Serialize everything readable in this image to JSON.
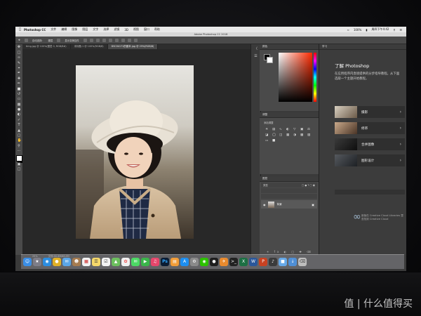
{
  "mac_menu": {
    "items": [
      "Photoshop CC",
      "文件",
      "编辑",
      "图像",
      "图层",
      "文字",
      "选择",
      "滤镜",
      "3D",
      "视图",
      "窗口",
      "帮助"
    ],
    "battery": "100%",
    "clock": "周四下午4:42"
  },
  "window_title": "Adobe Photoshop CC 2018",
  "options_bar": {
    "auto_select": "自动选择:",
    "layer": "图层",
    "show_transform": "显示变换控件"
  },
  "doc_tabs": [
    "timg.jpg @ 100%(图层 0, RGB/8#)",
    "未标题-1 @ 100%(RGB/8)",
    "DSC04171的副本.jpg @ 25%(RGB/8)"
  ],
  "status": {
    "zoom": "25%",
    "doc_info": "文档:68.8M/68.8M"
  },
  "panels": {
    "color_tab": "颜色",
    "adjustments_tab": "调整",
    "adjustments_sub": "添加调整",
    "layers_tab": "图层",
    "layers_kind": "类型",
    "layer_name": "背景"
  },
  "learn": {
    "tab": "学习",
    "title": "了解 Photoshop",
    "description": "在应用程序内直接提供的分步指导教程。从下面选取一个主题开始教程。",
    "cards": [
      "摄影",
      "修饰",
      "合并图像",
      "图形设计"
    ],
    "footer": "新版在 Creative Cloud Libraries 里查找到 Creative Cloud"
  },
  "dock_apps": [
    "finder",
    "launchpad",
    "safari",
    "chrome",
    "mail",
    "contacts",
    "calendar",
    "notes",
    "reminders",
    "maps",
    "photos",
    "messages",
    "facetime",
    "itunes",
    "photoshop",
    "ibooks",
    "appstore",
    "preferences",
    "wechat",
    "qq",
    "thunderbird",
    "terminal",
    "excel",
    "word",
    "powerpoint",
    "music",
    "folder",
    "downloads",
    "trash"
  ],
  "watermark": "值 | 什么值得买"
}
